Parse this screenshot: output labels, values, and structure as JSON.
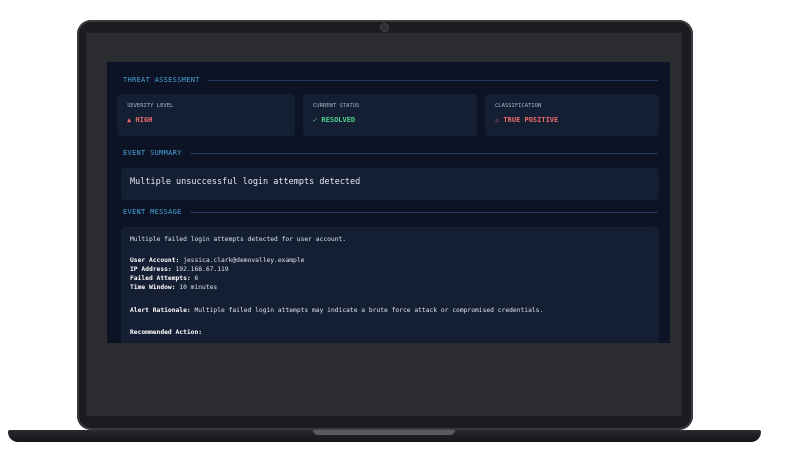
{
  "threat_assessment": {
    "title": "THREAT ASSESSMENT",
    "cards": [
      {
        "label": "SEVERITY LEVEL",
        "value": "▲ HIGH",
        "color": "#f06b6b"
      },
      {
        "label": "CURRENT STATUS",
        "value": "✓ RESOLVED",
        "color": "#4ed28b"
      },
      {
        "label": "CLASSIFICATION",
        "value": "⚠ TRUE POSITIVE",
        "color": "#f06b6b"
      }
    ]
  },
  "event_summary": {
    "title": "EVENT SUMMARY",
    "text": "Multiple unsuccessful login attempts detected"
  },
  "event_message": {
    "title": "EVENT MESSAGE",
    "intro": "Multiple failed login attempts detected for user account.",
    "fields": [
      {
        "label": "User Account:",
        "value": "jessica.clark@demovalley.example"
      },
      {
        "label": "IP Address:",
        "value": "192.168.67.119"
      },
      {
        "label": "Failed Attempts:",
        "value": "6"
      },
      {
        "label": "Time Window:",
        "value": "10 minutes"
      }
    ],
    "rationale_label": "Alert Rationale:",
    "rationale": "Multiple failed login attempts may indicate a brute force attack or compromised credentials.",
    "action_label": "Recommended Action:"
  }
}
